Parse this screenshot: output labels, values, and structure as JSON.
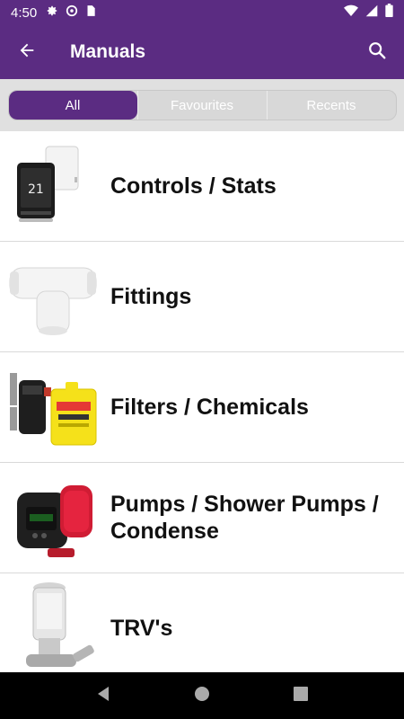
{
  "status_bar": {
    "time": "4:50",
    "icons_left": [
      "gear-icon",
      "at-sign-icon",
      "sd-card-icon"
    ],
    "icons_right": [
      "wifi-icon",
      "signal-icon",
      "battery-icon"
    ]
  },
  "app_bar": {
    "title": "Manuals",
    "back_icon": "arrow-left-icon",
    "search_icon": "search-icon",
    "background_color": "#5b2c82"
  },
  "tabs": [
    {
      "label": "All",
      "active": true
    },
    {
      "label": "Favourites",
      "active": false
    },
    {
      "label": "Recents",
      "active": false
    }
  ],
  "categories": [
    {
      "label": "Controls / Stats",
      "icon": "thermostat-image"
    },
    {
      "label": "Fittings",
      "icon": "pipe-fitting-image"
    },
    {
      "label": "Filters / Chemicals",
      "icon": "filter-chemical-image"
    },
    {
      "label": "Pumps / Shower Pumps / Condense",
      "icon": "pump-image"
    },
    {
      "label": "TRV's",
      "icon": "radiator-valve-image"
    }
  ],
  "nav_bar": {
    "buttons": [
      "back-triangle-icon",
      "home-circle-icon",
      "recents-square-icon"
    ]
  }
}
